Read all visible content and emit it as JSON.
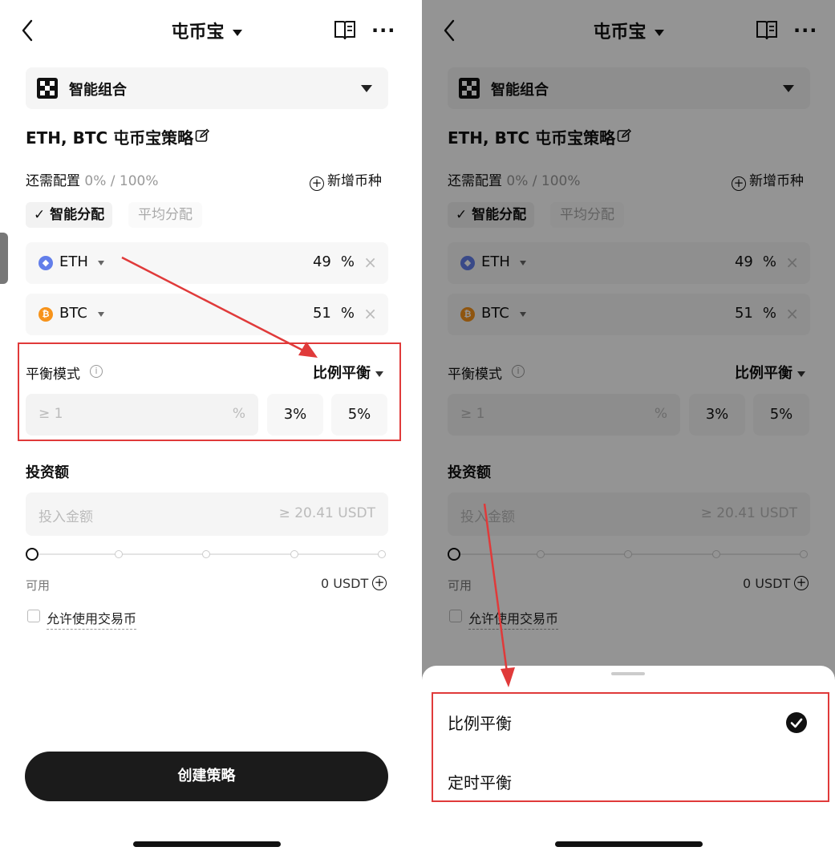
{
  "header": {
    "title": "屯币宝",
    "more": "···"
  },
  "selector": {
    "label": "智能组合"
  },
  "strategy": {
    "name": "ETH, BTC 屯币宝策略"
  },
  "config": {
    "label": "还需配置",
    "value": "0% / 100%",
    "add_coin": "新增币种"
  },
  "allocation": {
    "smart": "智能分配",
    "smart_check": "✓",
    "average": "平均分配"
  },
  "coins": [
    {
      "symbol": "ETH",
      "percent": "49",
      "unit": "%",
      "icon": "eth-icon",
      "color": "#627EEA",
      "glyph": "◆"
    },
    {
      "symbol": "BTC",
      "percent": "51",
      "unit": "%",
      "icon": "btc-icon",
      "color": "#F7931A",
      "glyph": "₿"
    }
  ],
  "balance": {
    "label": "平衡模式",
    "info": "i",
    "mode": "比例平衡",
    "threshold_placeholder": "≥ 1",
    "threshold_unit": "%",
    "chips": [
      "3%",
      "5%"
    ]
  },
  "invest": {
    "label": "投资额",
    "placeholder": "投入金额",
    "min": "≥ 20.41 USDT",
    "slider_value": 0
  },
  "available": {
    "label": "可用",
    "value": "0 USDT",
    "plus": "+"
  },
  "allow_trade_coin": {
    "label": "允许使用交易币",
    "checked": false
  },
  "create_button": "创建策略",
  "sheet": {
    "options": [
      {
        "label": "比例平衡",
        "selected": true
      },
      {
        "label": "定时平衡",
        "selected": false
      }
    ]
  },
  "colors": {
    "highlight": "#e03a3a",
    "accent_dark": "#1b1b1b"
  }
}
